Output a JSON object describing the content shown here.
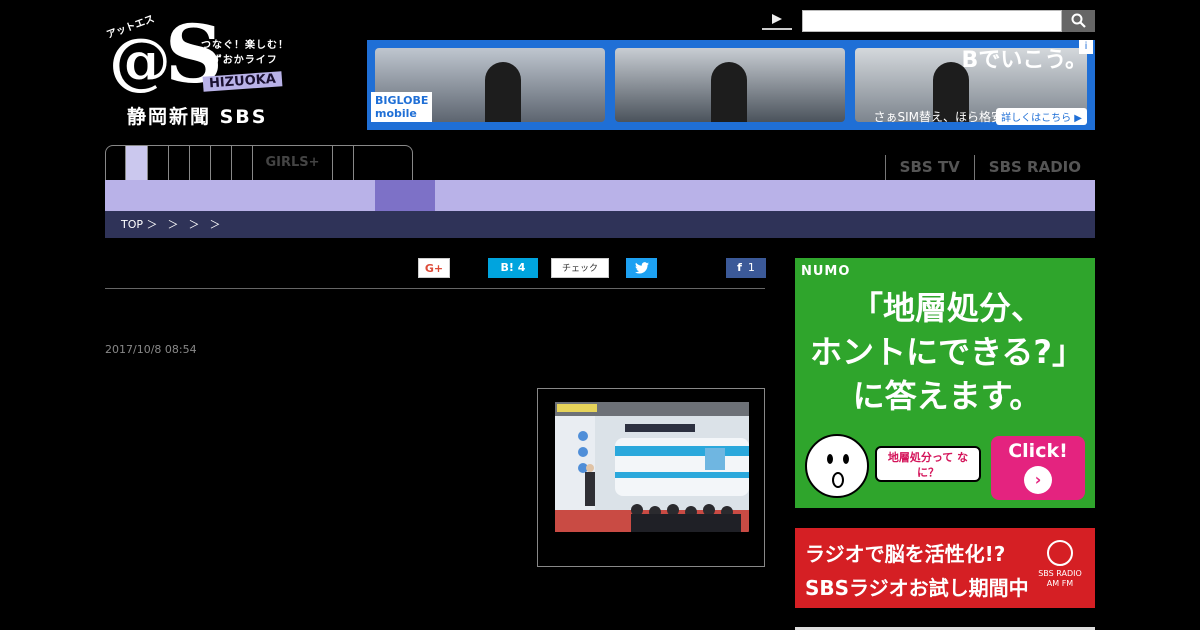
{
  "logo": {
    "small": "アットエス",
    "at": "@",
    "s": "S",
    "tagline1": "つなぐ！楽しむ！",
    "tagline2": "しずおかライフ",
    "region": "HIZUOKA",
    "sub": "静岡新聞 SBS"
  },
  "search": {
    "placeholder": "",
    "value": ""
  },
  "top_ad": {
    "logo_line1": "BIGLOBE",
    "logo_line2": "mobile",
    "headline": "Bでいこう。",
    "sub": "さぁSIM替え、ほら格安。",
    "cta": "詳しくはこちら ▶",
    "info": "i"
  },
  "nav": {
    "girls_label": "GIRLS+",
    "sbs_tv": "SBS TV",
    "sbs_radio": "SBS RADIO"
  },
  "breadcrumb": [
    "TOP ＞",
    "＞",
    "＞",
    "＞"
  ],
  "share": {
    "gplus": "G+",
    "hatena": "B! 4",
    "mixi": "チェック",
    "twitter": "🐦",
    "facebook": "f",
    "facebook_count": "1"
  },
  "article": {
    "timestamp": "2017/10/8 08:54"
  },
  "numo_ad": {
    "logo": "NUMO",
    "headline1": "「地層処分、",
    "headline2": "ホントにできる?」",
    "headline3": "に答えます。",
    "bubble": "地層処分って なに？",
    "click": "Click!",
    "arrow": "›"
  },
  "radio_ad": {
    "line1": "ラジオで脳を活性化!?",
    "line2": "SBSラジオお試し期間中",
    "logo1": "SBS RADIO",
    "logo2": "AM FM"
  }
}
